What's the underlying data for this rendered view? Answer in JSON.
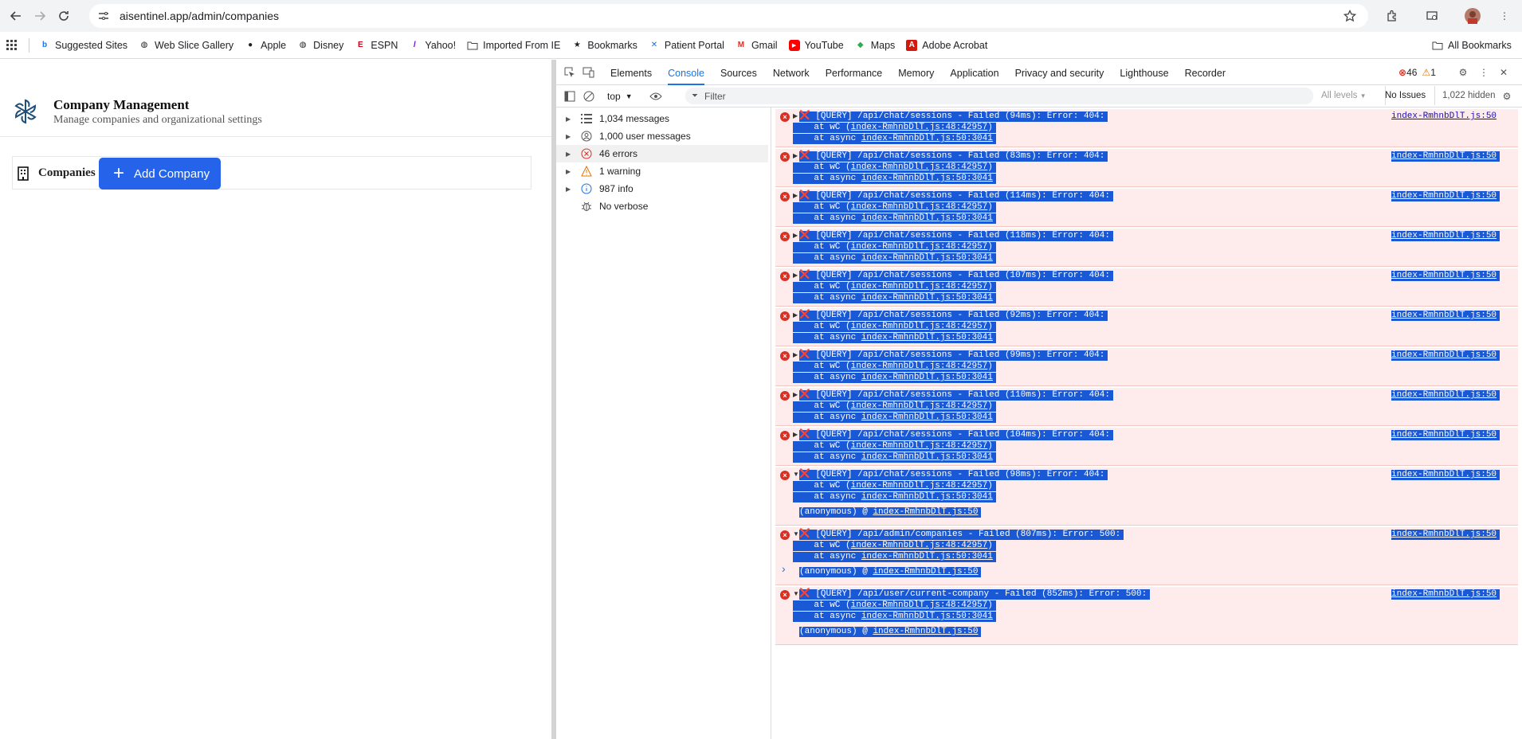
{
  "browser": {
    "url": "aisentinel.app/admin/companies",
    "bookmarks": [
      "Suggested Sites",
      "Web Slice Gallery",
      "Apple",
      "Disney",
      "ESPN",
      "Yahoo!",
      "Imported From IE",
      "Bookmarks",
      "Patient Portal",
      "Gmail",
      "YouTube",
      "Maps",
      "Adobe Acrobat"
    ],
    "all_bookmarks": "All Bookmarks"
  },
  "page": {
    "title": "Company Management",
    "subtitle": "Manage companies and organizational settings",
    "card_title": "Companies",
    "add_button": "Add Company"
  },
  "devtools": {
    "tabs": [
      "Elements",
      "Console",
      "Sources",
      "Network",
      "Performance",
      "Memory",
      "Application",
      "Privacy and security",
      "Lighthouse",
      "Recorder"
    ],
    "active_tab": "Console",
    "error_count": "46",
    "warning_count": "1",
    "context": "top",
    "filter_placeholder": "Filter",
    "levels": "All levels",
    "issues": "No Issues",
    "hidden": "1,022 hidden",
    "sidebar": [
      {
        "label": "1,034 messages",
        "icon": "list-icon"
      },
      {
        "label": "1,000 user messages",
        "icon": "user-icon"
      },
      {
        "label": "46 errors",
        "icon": "error-icon"
      },
      {
        "label": "1 warning",
        "icon": "warning-icon"
      },
      {
        "label": "987 info",
        "icon": "info-icon"
      },
      {
        "label": "No verbose",
        "icon": "bug-icon"
      }
    ],
    "console_entries": [
      {
        "msg": "[QUERY] /api/chat/sessions - Failed (94ms): Error: 404:",
        "at1": "index-RmhnbDlT.js:48:42957",
        "at2": "index-RmhnbDlT.js:50:3041",
        "source": "index-RmhnbDlT.js:50"
      },
      {
        "msg": "[QUERY] /api/chat/sessions - Failed (83ms): Error: 404:",
        "at1": "index-RmhnbDlT.js:48:42957",
        "at2": "index-RmhnbDlT.js:50:3041",
        "source": "index-RmhnbDlT.js:50"
      },
      {
        "msg": "[QUERY] /api/chat/sessions - Failed (114ms): Error: 404:",
        "at1": "index-RmhnbDlT.js:48:42957",
        "at2": "index-RmhnbDlT.js:50:3041",
        "source": "index-RmhnbDlT.js:50"
      },
      {
        "msg": "[QUERY] /api/chat/sessions - Failed (118ms): Error: 404:",
        "at1": "index-RmhnbDlT.js:48:42957",
        "at2": "index-RmhnbDlT.js:50:3041",
        "source": "index-RmhnbDlT.js:50"
      },
      {
        "msg": "[QUERY] /api/chat/sessions - Failed (107ms): Error: 404:",
        "at1": "index-RmhnbDlT.js:48:42957",
        "at2": "index-RmhnbDlT.js:50:3041",
        "source": "index-RmhnbDlT.js:50"
      },
      {
        "msg": "[QUERY] /api/chat/sessions - Failed (92ms): Error: 404:",
        "at1": "index-RmhnbDlT.js:48:42957",
        "at2": "index-RmhnbDlT.js:50:3041",
        "source": "index-RmhnbDlT.js:50"
      },
      {
        "msg": "[QUERY] /api/chat/sessions - Failed (99ms): Error: 404:",
        "at1": "index-RmhnbDlT.js:48:42957",
        "at2": "index-RmhnbDlT.js:50:3041",
        "source": "index-RmhnbDlT.js:50"
      },
      {
        "msg": "[QUERY] /api/chat/sessions - Failed (110ms): Error: 404:",
        "at1": "index-RmhnbDlT.js:48:42957",
        "at2": "index-RmhnbDlT.js:50:3041",
        "source": "index-RmhnbDlT.js:50"
      },
      {
        "msg": "[QUERY] /api/chat/sessions - Failed (104ms): Error: 404:",
        "at1": "index-RmhnbDlT.js:48:42957",
        "at2": "index-RmhnbDlT.js:50:3041",
        "source": "index-RmhnbDlT.js:50"
      },
      {
        "msg": "[QUERY] /api/chat/sessions - Failed (98ms): Error: 404:",
        "at1": "index-RmhnbDlT.js:48:42957",
        "at2": "index-RmhnbDlT.js:50:3041",
        "source": "index-RmhnbDlT.js:50",
        "anon": "(anonymous)",
        "anon_src": "index-RmhnbDlT.js:50"
      },
      {
        "msg": "[QUERY] /api/admin/companies - Failed (807ms): Error: 500:",
        "at1": "index-RmhnbDlT.js:48:42957",
        "at2": "index-RmhnbDlT.js:50:3041",
        "source": "index-RmhnbDlT.js:50",
        "anon": "(anonymous)",
        "anon_src": "index-RmhnbDlT.js:50"
      },
      {
        "msg": "[QUERY] /api/user/current-company - Failed (852ms): Error: 500:",
        "at1": "index-RmhnbDlT.js:48:42957",
        "at2": "index-RmhnbDlT.js:50:3041",
        "source": "index-RmhnbDlT.js:50",
        "anon": "(anonymous)",
        "anon_src": "index-RmhnbDlT.js:50"
      }
    ]
  }
}
